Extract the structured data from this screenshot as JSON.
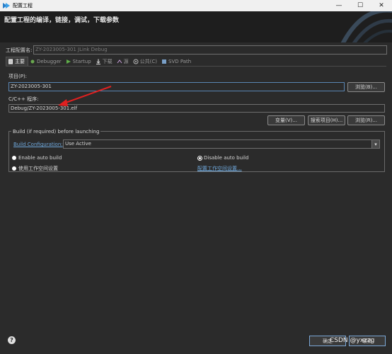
{
  "window": {
    "title": "配置工程",
    "min": "—",
    "max": "☐",
    "close": "✕"
  },
  "header": {
    "title": "配置工程的编译，链接，调试，下载参数"
  },
  "config": {
    "name_label": "工程配置名:",
    "name_value": "ZY-2023005-301 JLink Debug"
  },
  "tabs": [
    {
      "label": "主要",
      "icon": "main-tab-icon"
    },
    {
      "label": "Debugger",
      "icon": "debugger-icon"
    },
    {
      "label": "Startup",
      "icon": "startup-icon"
    },
    {
      "label": "下载",
      "icon": "download-icon"
    },
    {
      "label": "源",
      "icon": "source-icon"
    },
    {
      "label": "公共(C)",
      "icon": "common-icon"
    },
    {
      "label": "SVD Path",
      "icon": "svd-icon"
    }
  ],
  "project": {
    "label": "项目(P):",
    "value": "ZY-2023005-301",
    "browse": "浏览(B)..."
  },
  "program": {
    "label": "C/C++ 程序:",
    "value": "Debug/ZY-2023005-301.elf"
  },
  "program_buttons": {
    "variables": "变量(V)...",
    "search": "搜索项目(H)...",
    "browse": "浏览(R)..."
  },
  "build": {
    "group_title": "Build (if required) before launching",
    "config_link": "Build Configuration:",
    "config_value": "Use Active",
    "enable": "Enable auto build",
    "disable": "Disable auto build",
    "workspace": "使用工作空间设置",
    "workspace_link": "配置工作空间设置..."
  },
  "footer": {
    "help": "?",
    "ok": "确定",
    "cancel": "取消",
    "watermark": "CSDN @yxzzg"
  }
}
